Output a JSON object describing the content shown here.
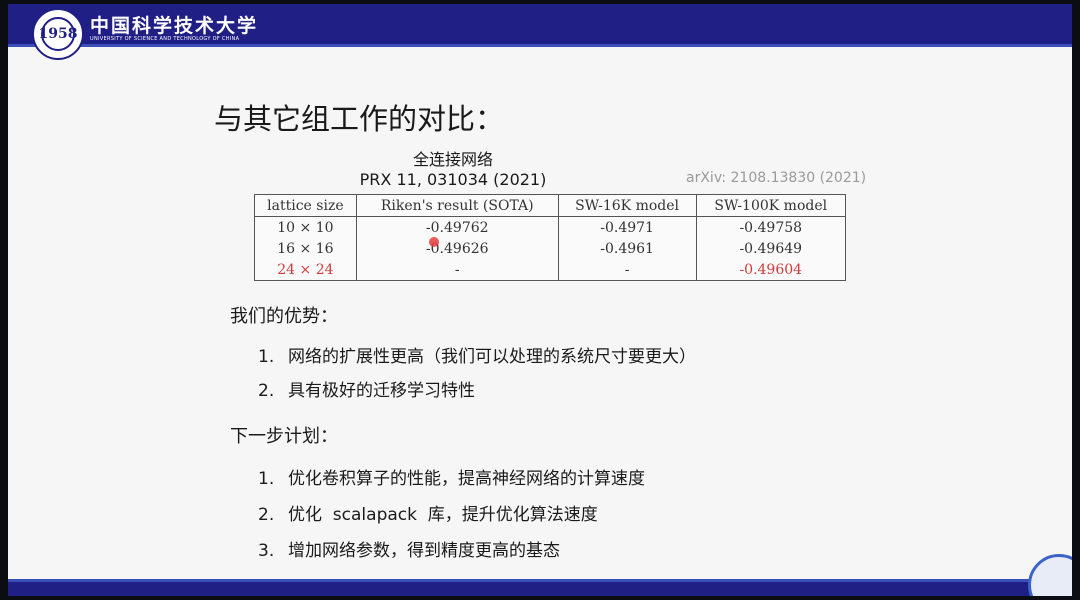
{
  "header": {
    "university_name": "中国科学技术大学",
    "university_english": "UNIVERSITY OF SCIENCE AND TECHNOLOGY OF CHINA",
    "logo_text": "1958"
  },
  "title": "与其它组工作的对比：",
  "table": {
    "caption_line1": "全连接网络",
    "caption_line2": "PRX 11, 031034 (2021)",
    "arxiv": "arXiv: 2108.13830 (2021)",
    "headers": [
      "lattice size",
      "Riken's result (SOTA)",
      "SW-16K model",
      "SW-100K model"
    ],
    "rows": [
      [
        "10 × 10",
        "-0.49762",
        "-0.4971",
        "-0.49758"
      ],
      [
        "16 × 16",
        "-0.49626",
        "-0.4961",
        "-0.49649"
      ],
      [
        "24 × 24",
        "-",
        "-",
        "-0.49604"
      ]
    ],
    "highlight_color": "#d23a3a"
  },
  "advantages": {
    "heading": "我们的优势：",
    "items": [
      {
        "num": "1.",
        "text": "网络的扩展性更高（我们可以处理的系统尺寸要更大）"
      },
      {
        "num": "2.",
        "text": "具有极好的迁移学习特性"
      }
    ]
  },
  "plan": {
    "heading": "下一步计划：",
    "items": [
      {
        "num": "1.",
        "text": "优化卷积算子的性能，提高神经网络的计算速度"
      },
      {
        "num": "2.",
        "text": "优化  scalapack  库，提升优化算法速度"
      },
      {
        "num": "3.",
        "text": "增加网络参数，得到精度更高的基态"
      }
    ]
  },
  "colors": {
    "header_blue": "#1f1f85",
    "accent_blue": "#3b4fb8"
  }
}
